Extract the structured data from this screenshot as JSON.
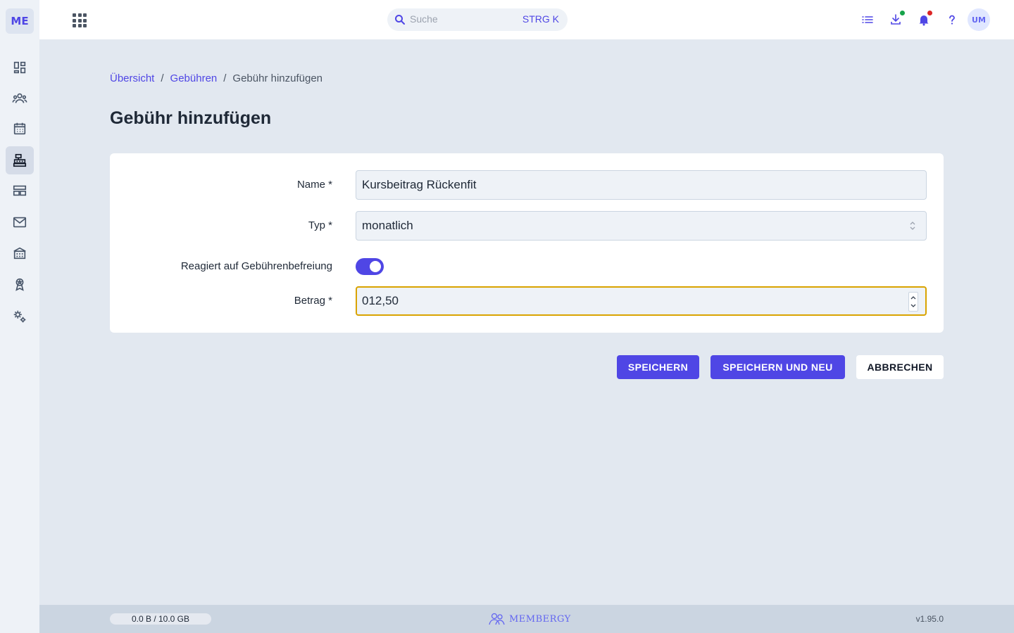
{
  "app": {
    "logo": "ME",
    "brand": "MEMBERGY",
    "version": "v1.95.0"
  },
  "sidebar": {
    "items": [
      {
        "icon": "dashboard-icon"
      },
      {
        "icon": "members-icon"
      },
      {
        "icon": "calendar-icon"
      },
      {
        "icon": "cash-register-icon",
        "active": true
      },
      {
        "icon": "table-layout-icon"
      },
      {
        "icon": "mail-icon"
      },
      {
        "icon": "building-icon"
      },
      {
        "icon": "award-icon"
      },
      {
        "icon": "settings-icon"
      }
    ]
  },
  "topbar": {
    "search_placeholder": "Suche",
    "search_shortcut": "STRG K",
    "avatar": "UM",
    "icons": [
      "list-icon",
      "download-icon",
      "bell-icon",
      "help-icon"
    ],
    "colors": {
      "download_dot": "#16a34a",
      "bell_dot": "#dc2626"
    }
  },
  "breadcrumb": {
    "home": "Übersicht",
    "section": "Gebühren",
    "current": "Gebühr hinzufügen"
  },
  "page": {
    "title": "Gebühr hinzufügen"
  },
  "form": {
    "name_label": "Name *",
    "name_value": "Kursbeitrag Rückenfit",
    "type_label": "Typ *",
    "type_value": "monatlich",
    "exemption_label": "Reagiert auf Gebührenbefreiung",
    "exemption_on": true,
    "amount_label": "Betrag *",
    "amount_value": "012,50"
  },
  "actions": {
    "save": "SPEICHERN",
    "save_new": "SPEICHERN UND NEU",
    "cancel": "ABBRECHEN"
  },
  "footer": {
    "storage": "0.0 B / 10.0 GB"
  },
  "colors": {
    "accent": "#4f46e5",
    "focus": "#d9a300"
  }
}
